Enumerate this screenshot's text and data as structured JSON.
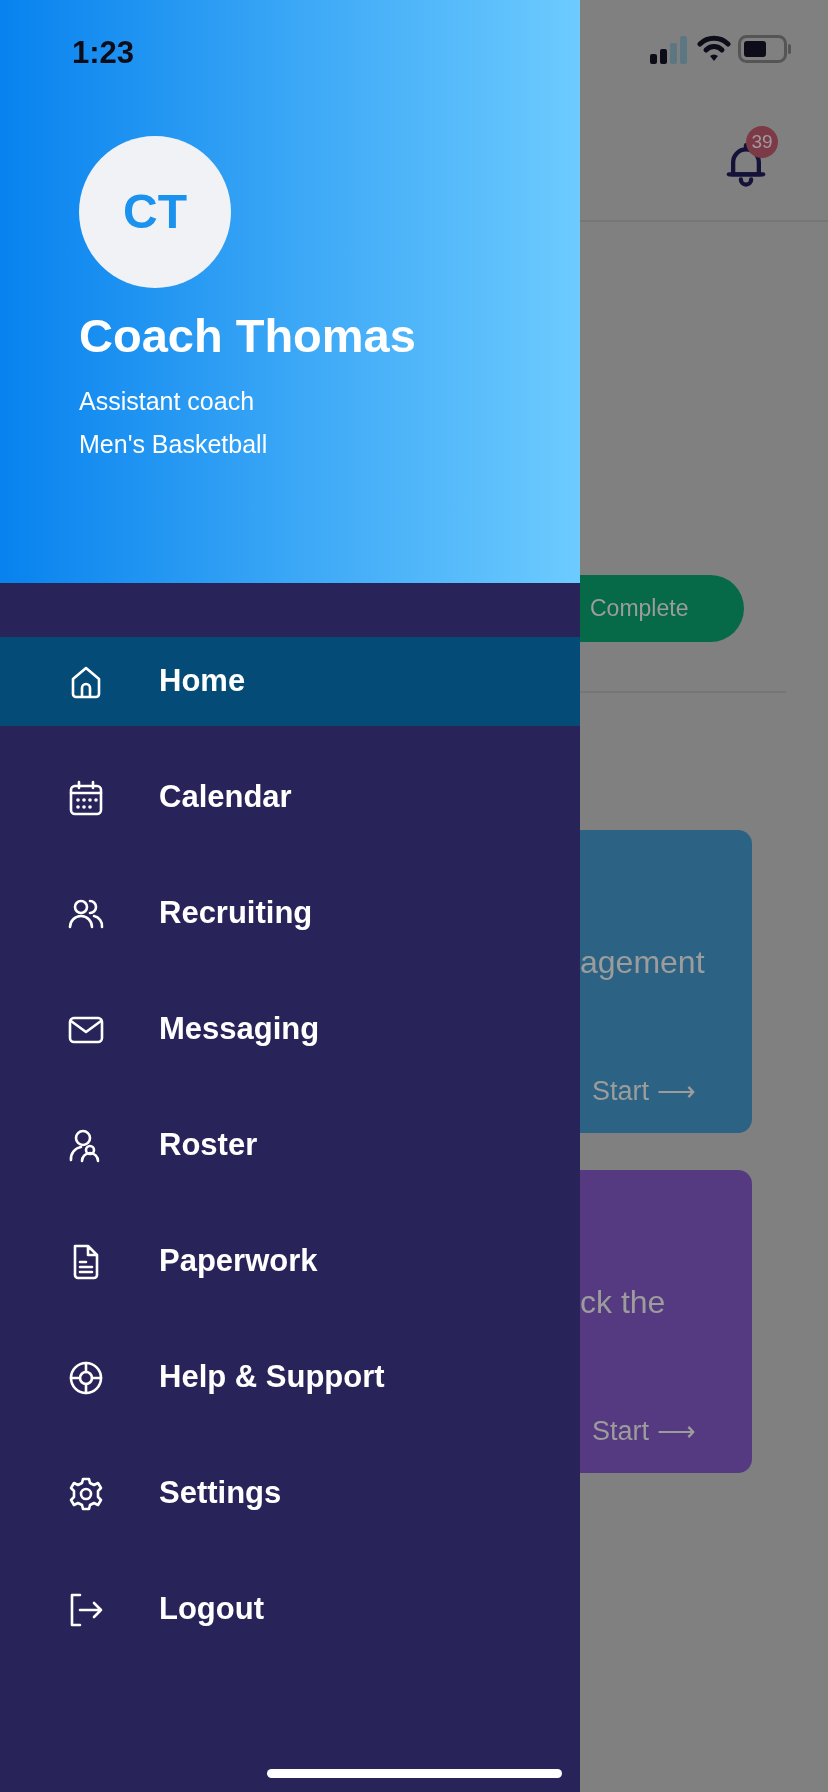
{
  "status_bar": {
    "time": "1:23"
  },
  "profile": {
    "initials": "CT",
    "name": "Coach Thomas",
    "role": "Assistant coach",
    "team": "Men's Basketball"
  },
  "menu": [
    {
      "label": "Home",
      "selected": true
    },
    {
      "label": "Calendar",
      "selected": false
    },
    {
      "label": "Recruiting",
      "selected": false
    },
    {
      "label": "Messaging",
      "selected": false
    },
    {
      "label": "Roster",
      "selected": false
    },
    {
      "label": "Paperwork",
      "selected": false
    },
    {
      "label": "Help & Support",
      "selected": false
    },
    {
      "label": "Settings",
      "selected": false
    },
    {
      "label": "Logout",
      "selected": false
    }
  ],
  "background": {
    "notification_count": "39",
    "status_button": "Complete",
    "cards": [
      {
        "text": "agement",
        "action": "Start ⟶",
        "color": "#2c6384"
      },
      {
        "text": "ck the",
        "action": "Start ⟶",
        "color": "#553a82"
      }
    ]
  }
}
